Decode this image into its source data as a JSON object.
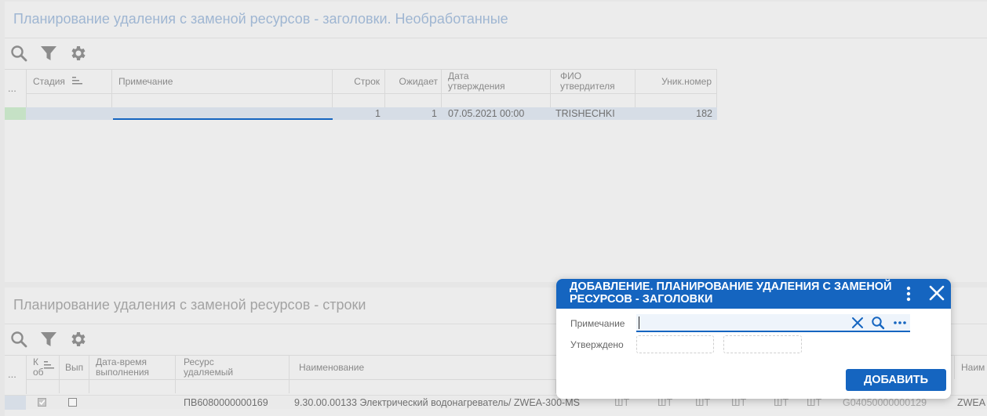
{
  "top_panel": {
    "title": "Планирование удаления с заменой ресурсов - заголовки. Необработанные",
    "toolbar": {
      "search": "search-icon",
      "filter": "filter-icon",
      "settings": "gear-icon"
    },
    "columns": {
      "more": "...",
      "stage": "Стадия",
      "note": "Примечание",
      "rows": "Строк",
      "waiting": "Ожидает",
      "date_line1": "Дата",
      "date_line2": "утверждения",
      "fio_line1": "ФИО",
      "fio_line2": "утвердителя",
      "uniq": "Уник.номер"
    },
    "row": {
      "rows": "1",
      "waiting": "1",
      "date": "07.05.2021 00:00",
      "fio": "TRISHECHKI",
      "uniq": "182"
    }
  },
  "bottom_panel": {
    "title": "Планирование удаления с заменой ресурсов - строки",
    "columns": {
      "more": "...",
      "k_line1": "К",
      "k_line2": "об",
      "done": "Вып",
      "dt_line1": "Дата-время",
      "dt_line2": "выполнения",
      "res_line1": "Ресурс",
      "res_line2": "удаляемый",
      "name": "Наименование",
      "name_right": "Наим"
    },
    "row": {
      "resource": "ПВ6080000000169",
      "name": "9.30.00.00133 Электрический водонагреватель/ ZWEA-300-MS",
      "unit1": "ШТ",
      "unit2": "ШТ",
      "unit3": "ШТ",
      "unit4": "ШТ",
      "unit5": "ШТ",
      "unit6": "ШТ",
      "code": "G04050000000129",
      "name2": "ZWEA"
    }
  },
  "dialog": {
    "title": "ДОБАВЛЕНИЕ. ПЛАНИРОВАНИЕ УДАЛЕНИЯ С ЗАМЕНОЙ РЕСУРСОВ - ЗАГОЛОВКИ",
    "note_label": "Примечание",
    "note_value": "",
    "approved_label": "Утверждено",
    "add_button": "ДОБАВИТЬ"
  },
  "colors": {
    "accent": "#1565c0",
    "row_selected": "#d6dde6",
    "row_marker": "#c5e1c5"
  }
}
